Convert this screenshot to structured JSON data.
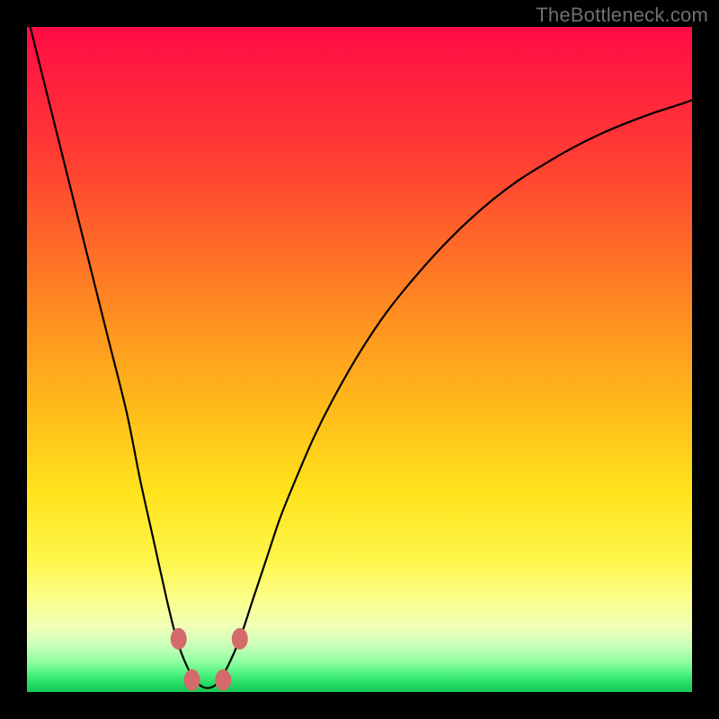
{
  "watermark": {
    "text": "TheBottleneck.com"
  },
  "colors": {
    "curve_stroke": "#000000",
    "marker_fill": "#d46a6a",
    "marker_stroke": "#b24e4e",
    "frame_bg": "#000000"
  },
  "chart_data": {
    "type": "line",
    "title": "",
    "xlabel": "",
    "ylabel": "",
    "xlim": [
      0,
      100
    ],
    "ylim": [
      0,
      100
    ],
    "grid": false,
    "legend": false,
    "series": [
      {
        "name": "curve",
        "x": [
          0,
          3,
          6,
          9,
          12,
          15,
          17,
          19,
          21,
          22.5,
          24,
          25.5,
          27,
          28.5,
          30,
          32,
          34,
          36,
          38,
          40,
          43,
          46,
          50,
          54,
          58,
          62,
          66,
          70,
          74,
          78,
          82,
          86,
          90,
          94,
          98,
          100
        ],
        "y": [
          102,
          90,
          78,
          66,
          54,
          42,
          32,
          23,
          14,
          8,
          4,
          1.5,
          0.6,
          1.2,
          3.5,
          8,
          14,
          20,
          26,
          31,
          38,
          44,
          51,
          57,
          62,
          66.5,
          70.5,
          74,
          77,
          79.5,
          81.8,
          83.8,
          85.5,
          87,
          88.3,
          89
        ]
      }
    ],
    "markers": [
      {
        "x": 22.8,
        "y": 8.0
      },
      {
        "x": 32.0,
        "y": 8.0
      },
      {
        "x": 24.8,
        "y": 1.8
      },
      {
        "x": 29.5,
        "y": 1.8
      }
    ]
  }
}
